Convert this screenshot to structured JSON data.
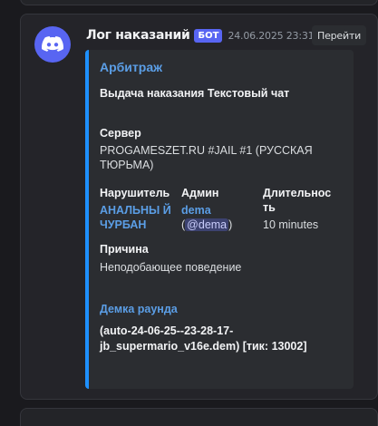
{
  "message": {
    "username": "Лог наказаний",
    "badge": "БОТ",
    "timestamp": "24.06.2025 23:31",
    "jump_label": "Перейти"
  },
  "embed": {
    "title": "Арбитраж",
    "description": "Выдача наказания Текстовый чат",
    "server_label": "Сервер",
    "server_value": "PROGAMESZET.RU #JAIL #1 (РУССКАЯ ТЮРЬМА)",
    "offender_label": "Нарушитель",
    "offender_value": "АНАЛЬНЫ Й ЧУРБАН",
    "admin_label": "Админ",
    "admin_name": "dema",
    "admin_paren_open": "(",
    "admin_mention": "@dema",
    "admin_paren_close": ")",
    "duration_label": "Длительнос ть",
    "duration_value": "10 minutes",
    "reason_label": "Причина",
    "reason_value": "Неподобающее поведение",
    "demo_title": "Демка раунда",
    "demo_value": "(auto-24-06-25--23-28-17-jb_supermario_v16e.dem) [тик: 13002]"
  },
  "colors": {
    "accent": "#5865f2",
    "embed_border": "#1e90ff",
    "link": "#5b9ee6"
  },
  "icons": {
    "avatar": "discord-logo-icon"
  }
}
